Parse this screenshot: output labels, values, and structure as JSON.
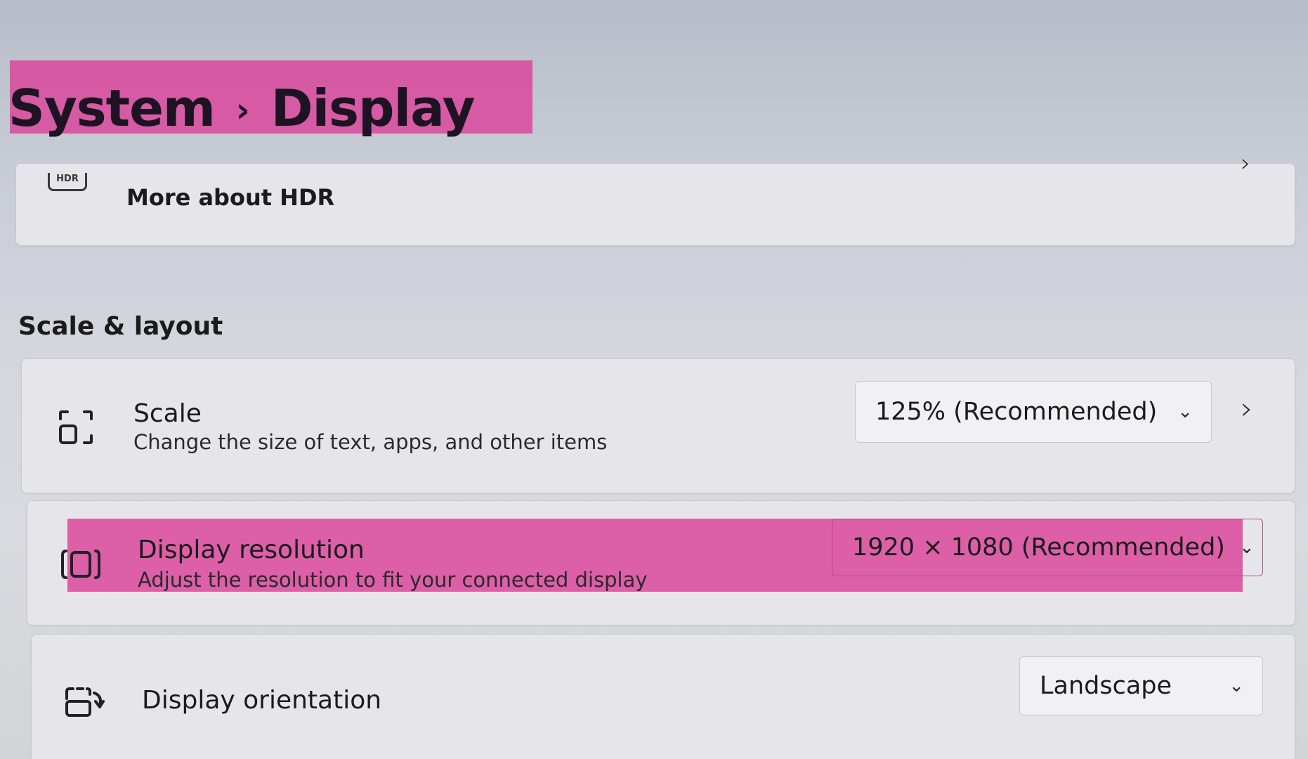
{
  "breadcrumb": {
    "parent": "System",
    "separator": "›",
    "current": "Display"
  },
  "hdr_card": {
    "icon": "hdr-icon",
    "icon_text": "HDR",
    "label": "More about HDR"
  },
  "section": {
    "title": "Scale & layout"
  },
  "scale": {
    "icon": "scale-icon",
    "title": "Scale",
    "description": "Change the size of text, apps, and other items",
    "value": "125% (Recommended)"
  },
  "resolution": {
    "icon": "resolution-icon",
    "title": "Display resolution",
    "description": "Adjust the resolution to fit your connected display",
    "value": "1920 × 1080 (Recommended)"
  },
  "orientation": {
    "icon": "orientation-icon",
    "title": "Display orientation",
    "value": "Landscape"
  },
  "colors": {
    "highlight": "#d9479c"
  }
}
